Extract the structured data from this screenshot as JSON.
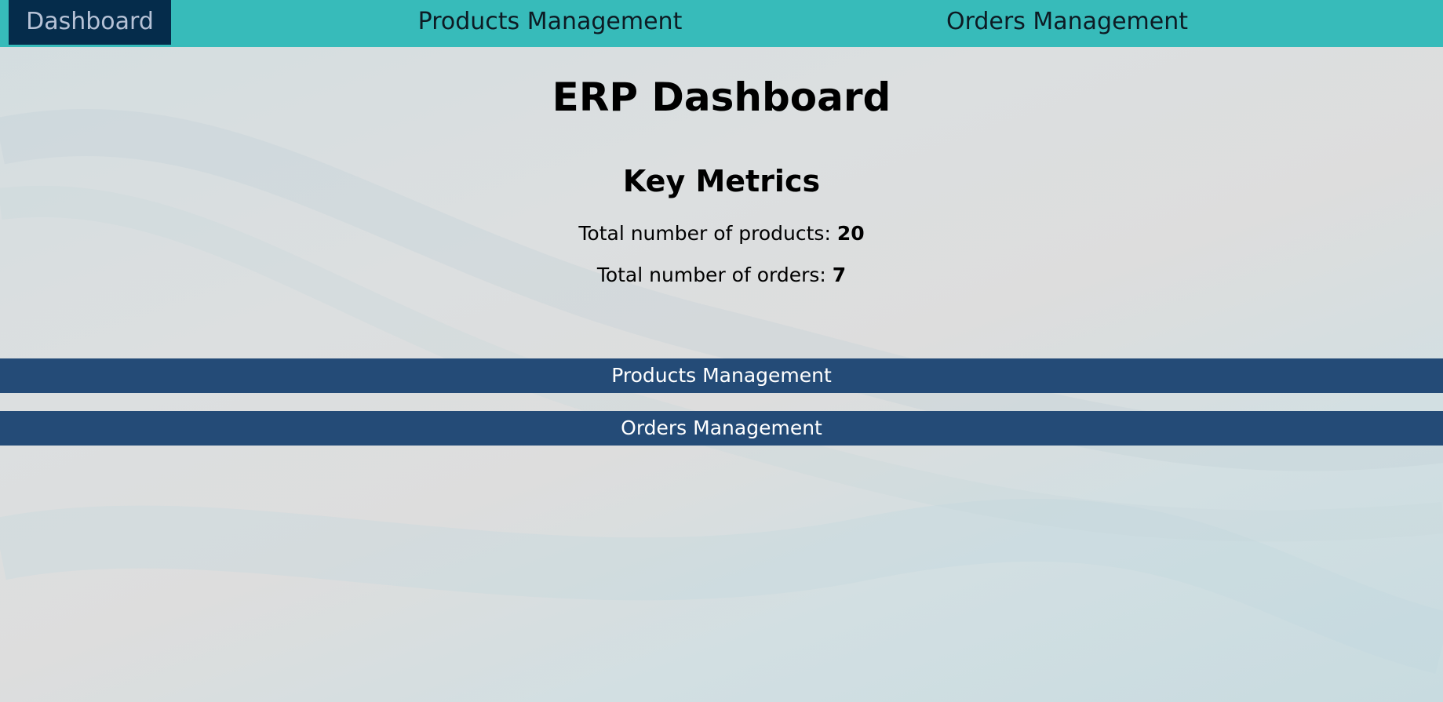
{
  "nav": {
    "items": [
      {
        "label": "Dashboard",
        "active": true
      },
      {
        "label": "Products Management",
        "active": false
      },
      {
        "label": "Orders Management",
        "active": false
      }
    ]
  },
  "page": {
    "title": "ERP Dashboard",
    "section_title": "Key Metrics"
  },
  "metrics": {
    "products_label": "Total number of products:",
    "products_value": "20",
    "orders_label": "Total number of orders:",
    "orders_value": "7"
  },
  "buttons": {
    "products": "Products Management",
    "orders": "Orders Management"
  },
  "colors": {
    "navbar": "#37bbba",
    "nav_active_bg": "#052c4b",
    "button_bg": "#244b77"
  }
}
